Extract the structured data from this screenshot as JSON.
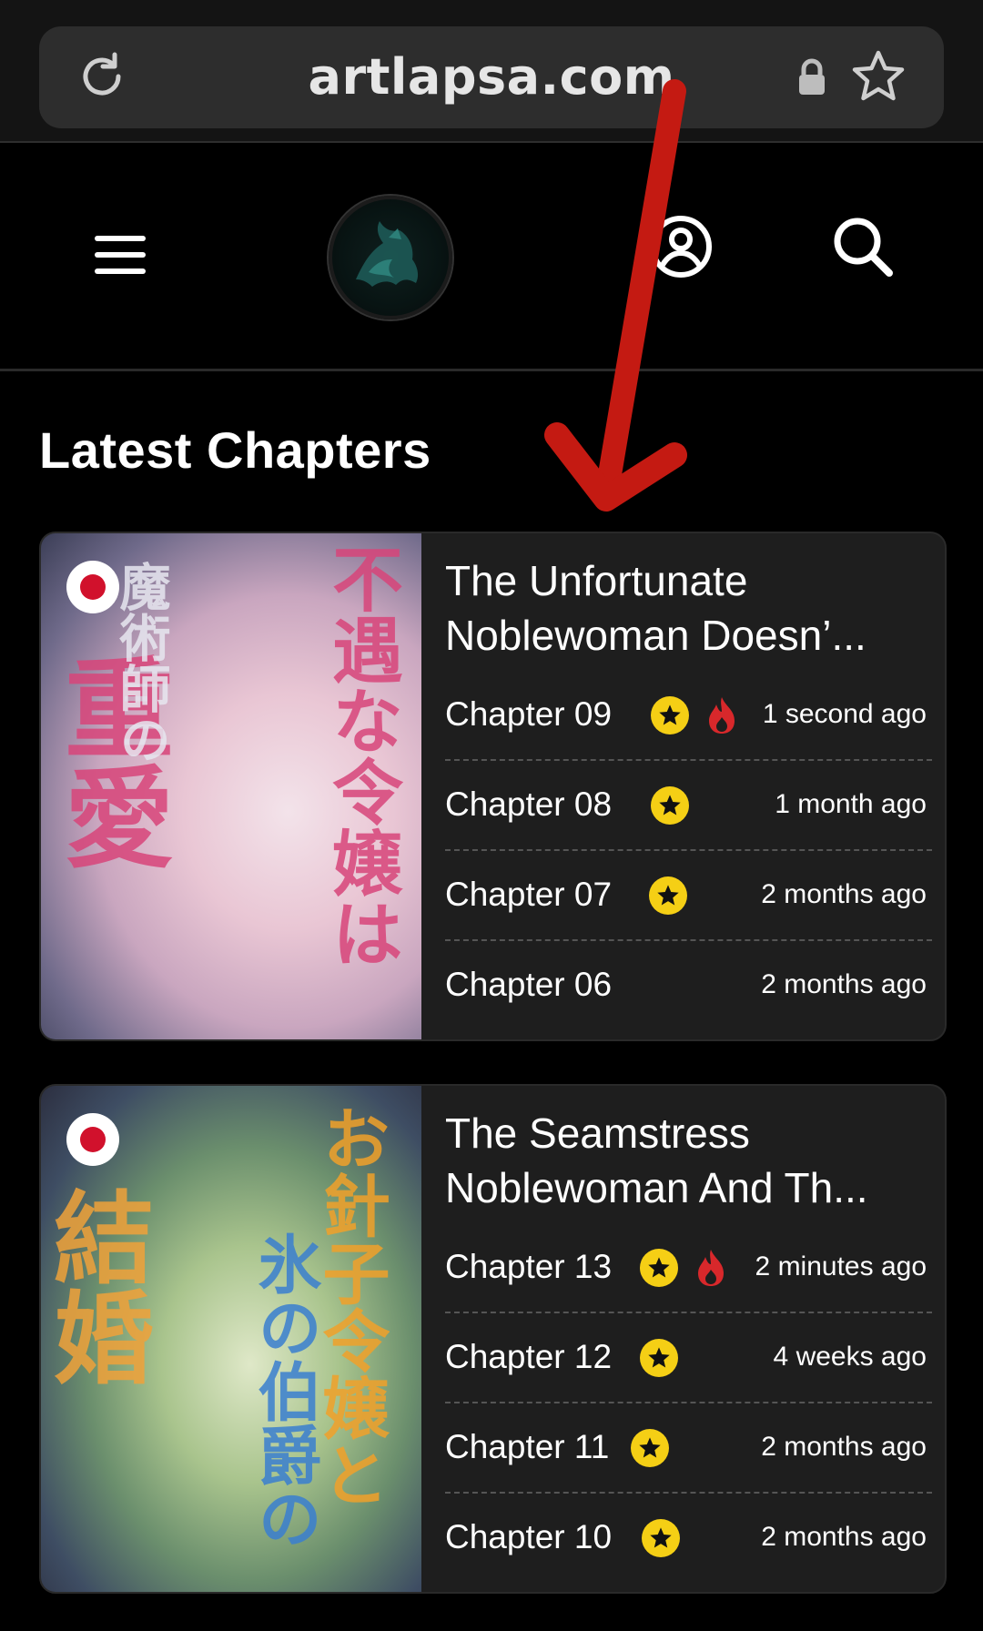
{
  "browser": {
    "url": "artlapsa.com"
  },
  "header": {
    "menu_icon": "hamburger-menu-icon",
    "logo_icon": "wolf-logo-icon",
    "user_icon": "user-account-icon",
    "search_icon": "search-icon"
  },
  "section_title": "Latest Chapters",
  "colors": {
    "background": "#000000",
    "card": "#1e1e1e",
    "star_badge": "#f5cf15",
    "fire_badge": "#d8282b",
    "annotation_arrow": "#c41a12"
  },
  "series": [
    {
      "title": "The Unfortunate Noblewoman Doesn’...",
      "title_line1": "The Unfortunate",
      "title_line2": "Noblewoman Doesn’...",
      "flag": "japan-flag-icon",
      "chapters": [
        {
          "label": "Chapter 09",
          "star": true,
          "fire": true,
          "time": "1 second ago"
        },
        {
          "label": "Chapter 08",
          "star": true,
          "fire": false,
          "time": "1 month ago"
        },
        {
          "label": "Chapter 07",
          "star": true,
          "fire": false,
          "time": "2 months ago"
        },
        {
          "label": "Chapter 06",
          "star": false,
          "fire": false,
          "time": "2 months ago"
        }
      ]
    },
    {
      "title": "The Seamstress Noblewoman And Th...",
      "title_line1": "The Seamstress",
      "title_line2": "Noblewoman And Th...",
      "flag": "japan-flag-icon",
      "chapters": [
        {
          "label": "Chapter 13",
          "star": true,
          "fire": true,
          "time": "2 minutes ago"
        },
        {
          "label": "Chapter 12",
          "star": true,
          "fire": false,
          "time": "4 weeks ago"
        },
        {
          "label": "Chapter 11",
          "star": true,
          "fire": false,
          "time": "2 months ago"
        },
        {
          "label": "Chapter 10",
          "star": true,
          "fire": false,
          "time": "2 months ago"
        }
      ]
    }
  ]
}
